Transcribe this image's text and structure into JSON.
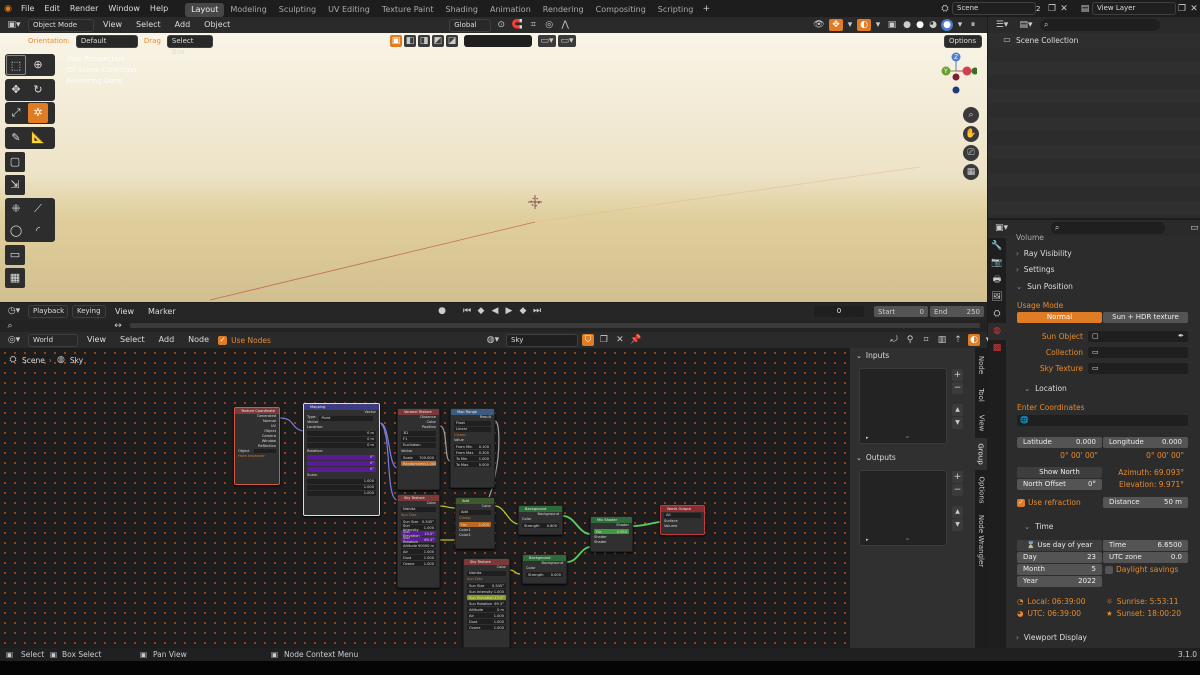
{
  "top_menu": [
    "File",
    "Edit",
    "Render",
    "Window",
    "Help"
  ],
  "workspace_tabs": [
    "Layout",
    "Modeling",
    "Sculpting",
    "UV Editing",
    "Texture Paint",
    "Shading",
    "Animation",
    "Rendering",
    "Compositing",
    "Scripting"
  ],
  "active_workspace": "Layout",
  "scene": {
    "name": "Scene",
    "users": "2"
  },
  "view_layer": "View Layer",
  "viewport_header": {
    "mode": "Object Mode",
    "menus": [
      "View",
      "Select",
      "Add",
      "Object"
    ],
    "transform": "Global"
  },
  "tool_settings": {
    "orientation_label": "Orientation:",
    "orientation_value": "Default",
    "drag_label": "Drag",
    "drag_value": "Select Box",
    "options": "Options"
  },
  "viewport_overlay": {
    "line1": "User Perspective",
    "line2": "(0) Scene Collection",
    "line3": "Rendering Done"
  },
  "gizmo": {
    "y_label": "Y",
    "z_label": "Z"
  },
  "timeline": {
    "menus": [
      "Playback",
      "Keying",
      "View",
      "Marker"
    ],
    "current_frame": "0",
    "start_label": "Start",
    "start": "0",
    "end_label": "End",
    "end": "250"
  },
  "node_header": {
    "type": "World",
    "menus": [
      "View",
      "Select",
      "Add",
      "Node"
    ],
    "use_nodes": "Use Nodes",
    "world_name": "Sky"
  },
  "node_breadcrumb": {
    "scene": "Scene",
    "world": "Sky"
  },
  "node_panel": {
    "inputs": "Inputs",
    "outputs": "Outputs"
  },
  "node_tabs": [
    "Node",
    "Tool",
    "View",
    "Group",
    "Options",
    "Node Wrangler"
  ],
  "outliner": {
    "title": "Scene Collection"
  },
  "properties": {
    "volume": "Volume",
    "ray_visibility": "Ray Visibility",
    "settings": "Settings",
    "sun_position": "Sun Position",
    "usage_mode_label": "Usage Mode",
    "usage_normal": "Normal",
    "usage_sun_hdr": "Sun + HDR texture",
    "sun_object": "Sun Object",
    "collection": "Collection",
    "sky_texture": "Sky Texture",
    "location": "Location",
    "enter_coordinates": "Enter Coordinates",
    "latitude_label": "Latitude",
    "latitude": "0.000",
    "longitude_label": "Longitude",
    "longitude": "0.000",
    "lat_dms": "0° 00' 00\"",
    "lon_dms": "0° 00' 00\"",
    "show_north": "Show North",
    "azimuth": "Azimuth: 69.093°",
    "north_offset_label": "North Offset",
    "north_offset": "0°",
    "elevation": "Elevation: 9.971°",
    "use_refraction": "Use refraction",
    "distance_label": "Distance",
    "distance": "50 m",
    "time": "Time",
    "use_day_of_year": "Use day of year",
    "time_label": "Time",
    "time_value": "6.6500",
    "day_label": "Day",
    "day": "23",
    "utc_zone_label": "UTC zone",
    "utc_zone": "0.0",
    "month_label": "Month",
    "month": "5",
    "daylight_savings": "Daylight savings",
    "year_label": "Year",
    "year": "2022",
    "local_time": "Local: 06:39:00",
    "utc_time": "UTC: 06:39:00",
    "sunrise": "Sunrise: 5:53:11",
    "sunset": "Sunset: 18:00:20",
    "viewport_display": "Viewport Display"
  },
  "statusbar": {
    "select": "Select",
    "box_select": "Box Select",
    "pan_view": "Pan View",
    "node_context_menu": "Node Context Menu",
    "version": "3.1.0"
  },
  "nodes": {
    "tex_coord": {
      "title": "Texture Coordinate",
      "outputs": [
        "Generated",
        "Normal",
        "UV",
        "Object",
        "Camera",
        "Window",
        "Reflection"
      ],
      "object": "Object",
      "from_instancer": "From Instancer"
    },
    "mapping": {
      "title": "Mapping",
      "vector": "Vector",
      "type_label": "Type:",
      "type": "Point",
      "vector_in": "Vector",
      "location": "Location:",
      "loc": [
        "0 m",
        "0 m",
        "0 m"
      ],
      "rotation": "Rotation:",
      "rot": [
        "0°",
        "0°",
        "0°"
      ],
      "scale": "Scale:",
      "scl": [
        "1.000",
        "1.000",
        "1.000"
      ]
    },
    "voronoi": {
      "title": "Voronoi Texture",
      "outputs": [
        "Distance",
        "Color",
        "Position"
      ],
      "dim": "3D",
      "feature": "F1",
      "metric": "Euclidean",
      "vector": "Vector",
      "scale_label": "Scale",
      "scale": "700.000",
      "rand_label": "Randomness",
      "rand": "1.000"
    },
    "color_ramp": {
      "title": "Map Range",
      "result": "Result",
      "mode": "Float",
      "interp": "Linear",
      "clamp": "Clamp",
      "value": "Value",
      "from_min_label": "From Min",
      "from_min": "0.100",
      "from_max_label": "From Max",
      "from_max": "0.300",
      "to_min_label": "To Min",
      "to_min": "1.000",
      "to_max_label": "To Max",
      "to_max": "0.000"
    },
    "sky1": {
      "title": "Sky Texture",
      "color": "Color",
      "type": "Nishita",
      "sun_disc": "Sun Disc",
      "sun_size_label": "Sun Size",
      "sun_size": "0.545°",
      "sun_int_label": "Sun Intensity",
      "sun_int": "1.000",
      "sun_elev_label": "Sun Elevation",
      "sun_elev": "13.5°",
      "sun_rot_label": "Sun Rotation",
      "sun_rot": "69.3°",
      "alt_label": "Altitude",
      "alt": "90000 m",
      "air_label": "Air",
      "air": "1.000",
      "dust_label": "Dust",
      "dust": "1.000",
      "ozone_label": "Ozone",
      "ozone": "1.000"
    },
    "sky2": {
      "title": "Sky Texture",
      "color": "Color",
      "type": "Nishita",
      "sun_disc": "Sun Disc",
      "sun_size_label": "Sun Size",
      "sun_size": "0.545°",
      "sun_int_label": "Sun Intensity",
      "sun_int": "1.000",
      "sun_elev_label": "Sun Elevation",
      "sun_elev": "13.5°",
      "sun_rot_label": "Sun Rotation",
      "sun_rot": "69.3°",
      "alt_label": "Altitude",
      "alt": "0 m",
      "air_label": "Air",
      "air": "1.000",
      "dust_label": "Dust",
      "dust": "1.000",
      "ozone_label": "Ozone",
      "ozone": "1.000"
    },
    "mix": {
      "title": "Add",
      "color": "Color",
      "mode": "Add",
      "clamp": "Clamp",
      "fac": "Fac",
      "fac_val": "1.000",
      "color1": "Color1",
      "color2": "Color2"
    },
    "bg1": {
      "title": "Background",
      "background": "Background",
      "color": "Color",
      "strength_label": "Strength",
      "strength": "0.800"
    },
    "bg2": {
      "title": "Background",
      "background": "Background",
      "color": "Color",
      "strength_label": "Strength",
      "strength": "0.000"
    },
    "mix_shader": {
      "title": "Mix Shader",
      "shader": "Shader",
      "fac": "Fac",
      "fac_val": "0.950",
      "shader1": "Shader",
      "shader2": "Shader"
    },
    "world_output": {
      "title": "World Output",
      "target": "All",
      "surface": "Surface",
      "volume": "Volume"
    }
  }
}
